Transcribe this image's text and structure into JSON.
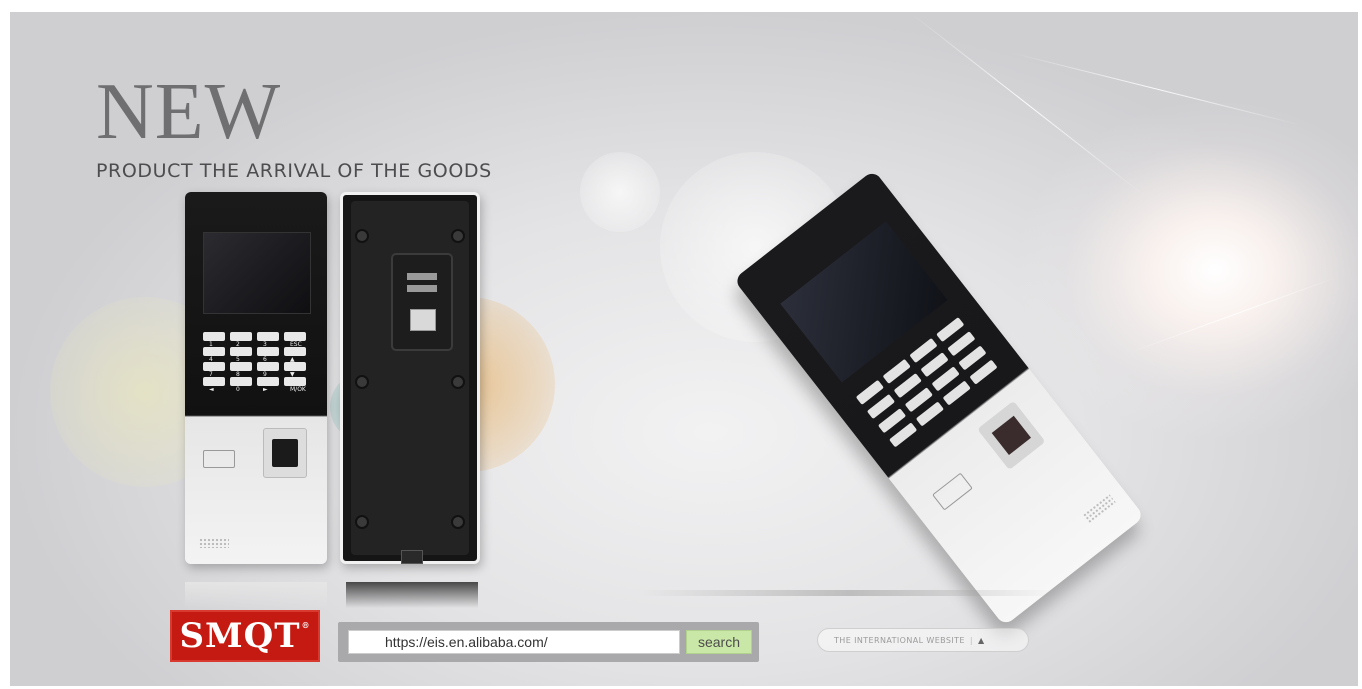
{
  "banner": {
    "headline": "NEW",
    "subheadline": "PRODUCT THE ARRIVAL OF THE GOODS"
  },
  "device_front": {
    "keys": [
      "1",
      "2",
      "3",
      "ESC",
      "4",
      "5",
      "6",
      "▲",
      "7",
      "8",
      "9",
      "▼",
      "◄",
      "0",
      "►",
      "M/OK"
    ]
  },
  "logo": {
    "text": "SMQT",
    "mark": "®"
  },
  "search": {
    "value": "https://eis.en.alibaba.com/",
    "button_label": "search"
  },
  "international": {
    "label": "THE INTERNATIONAL WEBSITE",
    "separator": "|",
    "icon": "triangle-up-icon"
  }
}
